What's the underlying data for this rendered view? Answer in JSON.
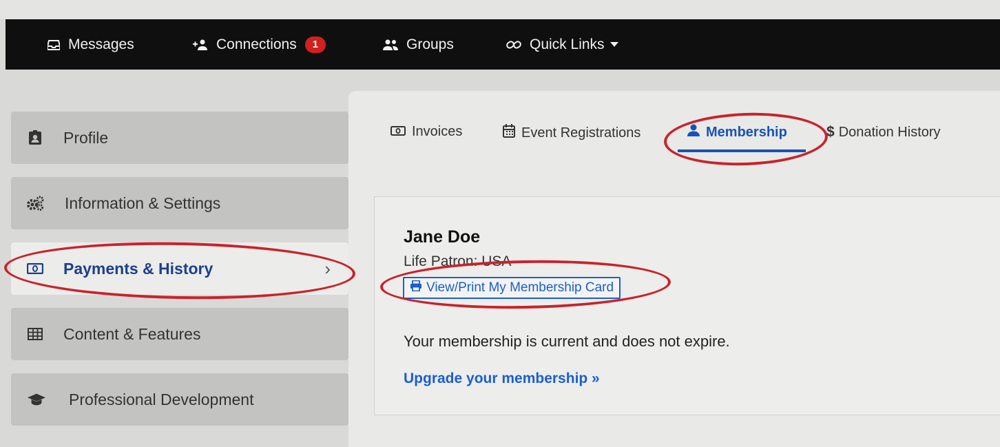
{
  "topnav": {
    "messages": {
      "label": "Messages",
      "icon": "inbox-icon"
    },
    "connections": {
      "label": "Connections",
      "badge": "1",
      "icon": "user-plus-icon"
    },
    "groups": {
      "label": "Groups",
      "icon": "users-icon"
    },
    "quick_links": {
      "label": "Quick Links",
      "icon": "link-icon"
    }
  },
  "sidebar": {
    "items": [
      {
        "label": "Profile",
        "icon": "id-badge-icon"
      },
      {
        "label": "Information & Settings",
        "icon": "gears-icon"
      },
      {
        "label": "Payments & History",
        "icon": "money-bill-icon",
        "active": true
      },
      {
        "label": "Content & Features",
        "icon": "table-icon"
      },
      {
        "label": "Professional Development",
        "icon": "graduation-cap-icon"
      }
    ],
    "active_chevron": "›"
  },
  "tabs": [
    {
      "label": "Invoices",
      "icon": "money-bill-icon"
    },
    {
      "label": "Event Registrations",
      "icon": "calendar-icon"
    },
    {
      "label": "Membership",
      "icon": "user-icon",
      "active": true
    },
    {
      "label": "Donation History",
      "icon": "dollar-icon"
    }
  ],
  "membership": {
    "name": "Jane Doe",
    "level": "Life Patron: USA",
    "card_button": "View/Print My Membership Card",
    "status": "Your membership is current and does not expire.",
    "upgrade_link": "Upgrade your membership »"
  },
  "colors": {
    "nav_bg": "#0f0f10",
    "accent": "#1653b8",
    "link": "#1a5fd0",
    "badge": "#d02020",
    "annotation": "#c8232c"
  }
}
